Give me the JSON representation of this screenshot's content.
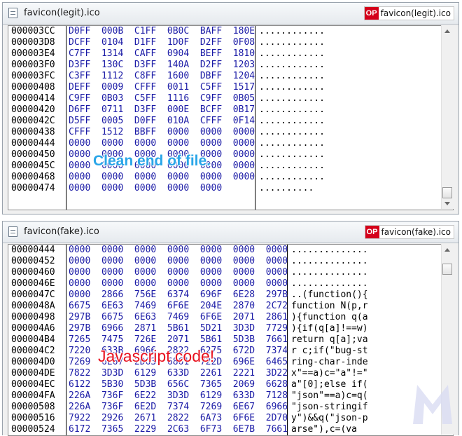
{
  "window_top": {
    "title": "favicon(legit).ico",
    "badge_logo": "OP",
    "badge_text": "favicon(legit).ico",
    "rows": [
      {
        "addr": "000003CC",
        "hex": "D0FF  000B  C1FF  0B0C  BAFF  180E",
        "ascii": "............"
      },
      {
        "addr": "000003D8",
        "hex": "DCFF  0104  D1FF  1D0F  D2FF  0F08",
        "ascii": "............"
      },
      {
        "addr": "000003E4",
        "hex": "C7FF  1314  CAFF  0904  BEFF  1810",
        "ascii": "............"
      },
      {
        "addr": "000003F0",
        "hex": "D3FF  130C  D3FF  140A  D2FF  1203",
        "ascii": "............"
      },
      {
        "addr": "000003FC",
        "hex": "C3FF  1112  C8FF  1600  DBFF  1204",
        "ascii": "............"
      },
      {
        "addr": "00000408",
        "hex": "DEFF  0009  CFFF  0011  C5FF  1517",
        "ascii": "............"
      },
      {
        "addr": "00000414",
        "hex": "C9FF  0B03  C5FF  1116  C9FF  0B05",
        "ascii": "............"
      },
      {
        "addr": "00000420",
        "hex": "D6FF  0711  D3FF  000E  BCFF  0B17",
        "ascii": "............"
      },
      {
        "addr": "0000042C",
        "hex": "D5FF  0005  D0FF  010A  CFFF  0F14",
        "ascii": "............"
      },
      {
        "addr": "00000438",
        "hex": "CFFF  1512  BBFF  0000  0000  0000",
        "ascii": "............"
      },
      {
        "addr": "00000444",
        "hex": "0000  0000  0000  0000  0000  0000",
        "ascii": "............"
      },
      {
        "addr": "00000450",
        "hex": "0000  0000  0000  0000  0000  0000",
        "ascii": "............"
      },
      {
        "addr": "0000045C",
        "hex": "0000  0000  0000  0000  0000  0000",
        "ascii": "............"
      },
      {
        "addr": "00000468",
        "hex": "0000  0000  0000  0000  0000  0000",
        "ascii": "............"
      },
      {
        "addr": "00000474",
        "hex": "0000  0000  0000  0000  0000",
        "ascii": ".........."
      }
    ],
    "annotation": "Clean end of file."
  },
  "window_bottom": {
    "title": "favicon(fake).ico",
    "badge_logo": "OP",
    "badge_text": "favicon(fake).ico",
    "rows": [
      {
        "addr": "00000444",
        "hex": "0000  0000  0000  0000  0000  0000  0000",
        "ascii": ".............."
      },
      {
        "addr": "00000452",
        "hex": "0000  0000  0000  0000  0000  0000  0000",
        "ascii": ".............."
      },
      {
        "addr": "00000460",
        "hex": "0000  0000  0000  0000  0000  0000  0000",
        "ascii": ".............."
      },
      {
        "addr": "0000046E",
        "hex": "0000  0000  0000  0000  0000  0000  0000",
        "ascii": ".............."
      },
      {
        "addr": "0000047C",
        "hex": "0000  2866  756E  6374  696F  6E28  297B",
        "ascii": "..(function(){"
      },
      {
        "addr": "0000048A",
        "hex": "6675  6E63  7469  6F6E  204E  2870  2C72",
        "ascii": "function N(p,r"
      },
      {
        "addr": "00000498",
        "hex": "297B  6675  6E63  7469  6F6E  2071  2861",
        "ascii": "){function q(a"
      },
      {
        "addr": "000004A6",
        "hex": "297B  6966  2871  5B61  5D21  3D3D  7729",
        "ascii": "){if(q[a]!==w)"
      },
      {
        "addr": "000004B4",
        "hex": "7265  7475  726E  2071  5B61  5D3B  7661",
        "ascii": "return q[a];va"
      },
      {
        "addr": "000004C2",
        "hex": "7220  633B  6966  2822  6275  672D  7374",
        "ascii": "r c;if(\"bug-st"
      },
      {
        "addr": "000004D0",
        "hex": "7269  6E67  2D63  6861  722D  696E  6465",
        "ascii": "ring-char-inde"
      },
      {
        "addr": "000004DE",
        "hex": "7822  3D3D  6129  633D  2261  2221  3D22",
        "ascii": "x\"==a)c=\"a\"!=\""
      },
      {
        "addr": "000004EC",
        "hex": "6122  5B30  5D3B  656C  7365  2069  6628",
        "ascii": "a\"[0];else if("
      },
      {
        "addr": "000004FA",
        "hex": "226A  736F  6E22  3D3D  6129  633D  7128",
        "ascii": "\"json\"==a)c=q("
      },
      {
        "addr": "00000508",
        "hex": "226A  736F  6E2D  7374  7269  6E67  6966",
        "ascii": "\"json-stringif"
      },
      {
        "addr": "00000516",
        "hex": "7922  2926  2671  2822  6A73  6F6E  2D70",
        "ascii": "y\")&&q(\"json-p"
      },
      {
        "addr": "00000524",
        "hex": "6172  7365  2229  2C63  6F73  6E7B  7661",
        "ascii": "arse\"),c=(va"
      }
    ],
    "annotation": "Javascript code!"
  },
  "colors": {
    "hex_text": "#1a1aa6",
    "annotation_top": "#2aa6e8",
    "annotation_bottom": "#e8121f",
    "logo_red": "#d4001a"
  },
  "icons": [
    "document-icon",
    "op-logo-icon",
    "malwarebytes-watermark-icon"
  ]
}
